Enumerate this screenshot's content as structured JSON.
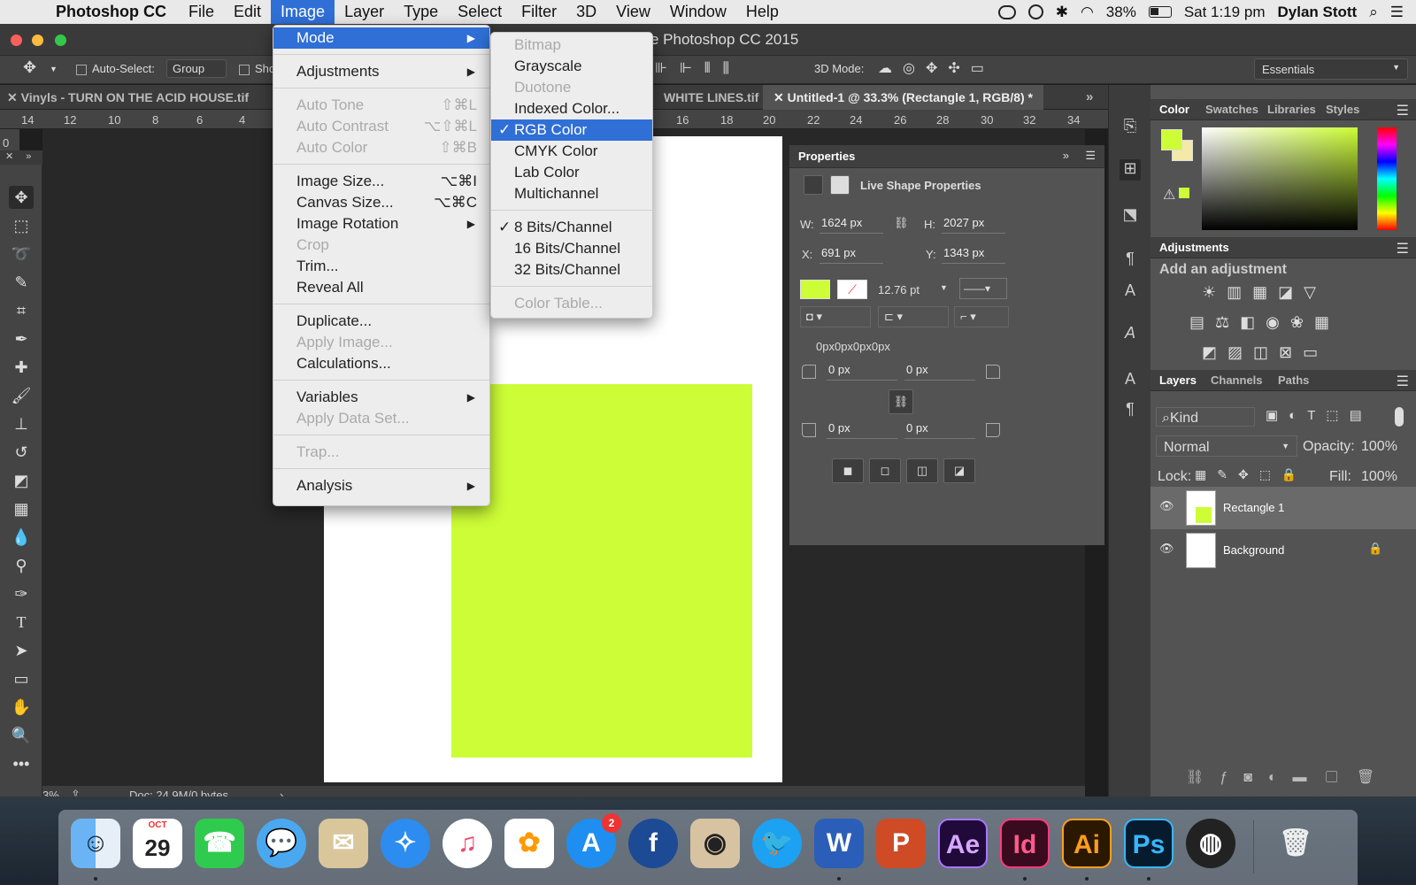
{
  "menubar": {
    "app_name": "Photoshop CC",
    "items": [
      "File",
      "Edit",
      "Image",
      "Layer",
      "Type",
      "Select",
      "Filter",
      "3D",
      "View",
      "Window",
      "Help"
    ],
    "battery": "38%",
    "clock": "Sat 1:19 pm",
    "user": "Dylan Stott"
  },
  "window": {
    "title": "e Photoshop CC 2015"
  },
  "options": {
    "auto_select_label": "Auto-Select:",
    "auto_select_value": "Group",
    "show_label": "Sho",
    "mode3d": "3D Mode:",
    "workspace": "Essentials"
  },
  "tabs": [
    {
      "label": "Vinyls - TURN ON THE ACID HOUSE.tif"
    },
    {
      "label": "WHITE LINES.tif"
    },
    {
      "label": "Untitled-1 @ 33.3% (Rectangle 1, RGB/8) *"
    }
  ],
  "ruler": {
    "left": [
      "14",
      "12",
      "10",
      "8",
      "6",
      "4"
    ],
    "right": [
      "16",
      "18",
      "20",
      "22",
      "24",
      "26",
      "28",
      "30",
      "32",
      "34"
    ],
    "vertical_zero": "0"
  },
  "status": {
    "zoom": "3%",
    "doc": "Doc: 24.9M/0 bytes"
  },
  "image_menu": {
    "items": [
      {
        "label": "Mode",
        "shortcut": "",
        "submenu": true,
        "disabled": false,
        "highlight": true
      },
      {
        "sep": true
      },
      {
        "label": "Adjustments",
        "shortcut": "",
        "submenu": true,
        "disabled": false
      },
      {
        "sep": true
      },
      {
        "label": "Auto Tone",
        "shortcut": "⇧⌘L",
        "disabled": true
      },
      {
        "label": "Auto Contrast",
        "shortcut": "⌥⇧⌘L",
        "disabled": true
      },
      {
        "label": "Auto Color",
        "shortcut": "⇧⌘B",
        "disabled": true
      },
      {
        "sep": true
      },
      {
        "label": "Image Size...",
        "shortcut": "⌥⌘I",
        "disabled": false
      },
      {
        "label": "Canvas Size...",
        "shortcut": "⌥⌘C",
        "disabled": false
      },
      {
        "label": "Image Rotation",
        "shortcut": "",
        "submenu": true,
        "disabled": false
      },
      {
        "label": "Crop",
        "shortcut": "",
        "disabled": true
      },
      {
        "label": "Trim...",
        "shortcut": "",
        "disabled": false
      },
      {
        "label": "Reveal All",
        "shortcut": "",
        "disabled": false
      },
      {
        "sep": true
      },
      {
        "label": "Duplicate...",
        "shortcut": "",
        "disabled": false
      },
      {
        "label": "Apply Image...",
        "shortcut": "",
        "disabled": true
      },
      {
        "label": "Calculations...",
        "shortcut": "",
        "disabled": false
      },
      {
        "sep": true
      },
      {
        "label": "Variables",
        "shortcut": "",
        "submenu": true,
        "disabled": false
      },
      {
        "label": "Apply Data Set...",
        "shortcut": "",
        "disabled": true
      },
      {
        "sep": true
      },
      {
        "label": "Trap...",
        "shortcut": "",
        "disabled": true
      },
      {
        "sep": true
      },
      {
        "label": "Analysis",
        "shortcut": "",
        "submenu": true,
        "disabled": false
      }
    ]
  },
  "mode_menu": {
    "items": [
      {
        "label": "Bitmap",
        "disabled": true
      },
      {
        "label": "Grayscale",
        "disabled": false
      },
      {
        "label": "Duotone",
        "disabled": true
      },
      {
        "label": "Indexed Color...",
        "disabled": false
      },
      {
        "label": "RGB Color",
        "disabled": false,
        "checked": true,
        "highlight": true
      },
      {
        "label": "CMYK Color",
        "disabled": false
      },
      {
        "label": "Lab Color",
        "disabled": false
      },
      {
        "label": "Multichannel",
        "disabled": false
      },
      {
        "sep": true
      },
      {
        "label": "8 Bits/Channel",
        "disabled": false,
        "checked": true
      },
      {
        "label": "16 Bits/Channel",
        "disabled": false
      },
      {
        "label": "32 Bits/Channel",
        "disabled": false
      },
      {
        "sep": true
      },
      {
        "label": "Color Table...",
        "disabled": true
      }
    ]
  },
  "properties": {
    "title": "Properties",
    "subtitle": "Live Shape Properties",
    "w_label": "W:",
    "w": "1624 px",
    "h_label": "H:",
    "h": "2027 px",
    "x_label": "X:",
    "x": "691 px",
    "y_label": "Y:",
    "y": "1343 px",
    "fill_color": "#ccfd36",
    "stroke_width": "12.76 pt",
    "corners_summary": "0px0px0px0px",
    "corner_tl": "0 px",
    "corner_tr": "0 px",
    "corner_bl": "0 px",
    "corner_br": "0 px"
  },
  "color_panel": {
    "tabs": [
      "Color",
      "Swatches",
      "Libraries",
      "Styles"
    ],
    "foreground": "#ccfd36",
    "background": "#f4e9a6"
  },
  "adjustments": {
    "title": "Adjustments",
    "hint": "Add an adjustment"
  },
  "layers": {
    "tabs": [
      "Layers",
      "Channels",
      "Paths"
    ],
    "kind": "Kind",
    "blend": "Normal",
    "opacity_label": "Opacity:",
    "opacity": "100%",
    "lock_label": "Lock:",
    "fill_label": "Fill:",
    "fill": "100%",
    "rows": [
      {
        "name": "Rectangle 1"
      },
      {
        "name": "Background"
      }
    ]
  },
  "dock": {
    "calendar_month": "OCT",
    "calendar_day": "29",
    "appstore_badge": "2",
    "app_labels": [
      "f",
      "W",
      "P",
      "Ae",
      "Id",
      "Ai",
      "Ps"
    ]
  },
  "colors": {
    "accent": "#2f6fd6",
    "shape": "#ccfd36"
  }
}
